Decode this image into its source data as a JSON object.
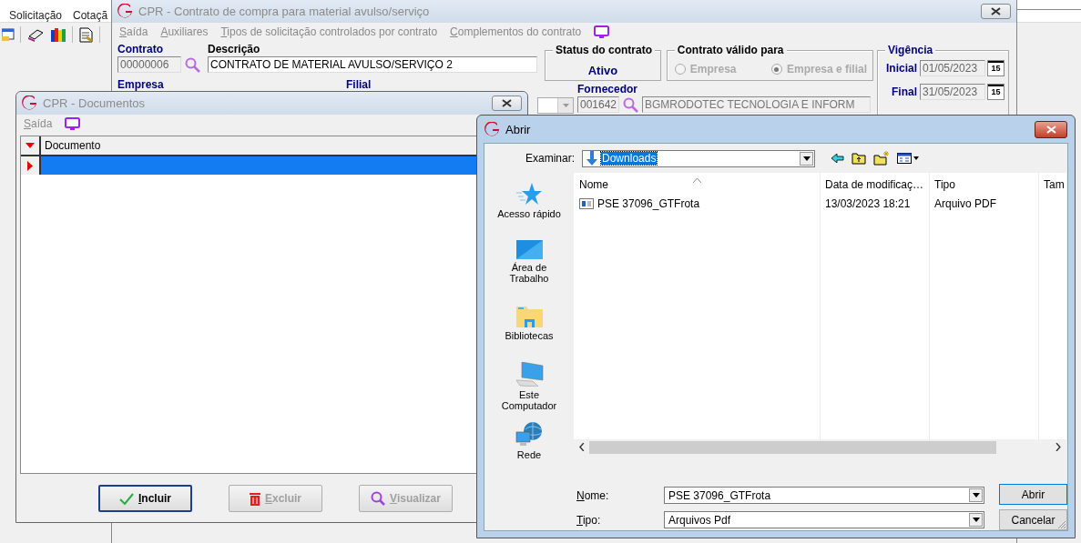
{
  "app": {
    "menu": [
      {
        "label": "Solicitação"
      },
      {
        "label": "Cotaçã"
      }
    ]
  },
  "contract_window": {
    "title": "CPR - Contrato de compra para material avulso/serviço",
    "menu": [
      {
        "label": "Saída"
      },
      {
        "label": "Auxiliares"
      },
      {
        "label": "Tipos de solicitação controlados por contrato"
      },
      {
        "label": "Complementos do contrato"
      }
    ],
    "contrato": {
      "label": "Contrato",
      "value": "00000006"
    },
    "descricao": {
      "label": "Descrição",
      "value": "CONTRATO DE MATERIAL AVULSO/SERVIÇO 2"
    },
    "status": {
      "label": "Status do contrato",
      "value": "Ativo"
    },
    "valid_for": {
      "label": "Contrato válido para",
      "disabled": true,
      "options": [
        {
          "label": "Empresa",
          "selected": false
        },
        {
          "label": "Empresa e filial",
          "selected": true
        }
      ]
    },
    "vigencia": {
      "label": "Vigência",
      "dates": [
        {
          "label": "Inicial",
          "value": "01/05/2023",
          "calendar": "15"
        },
        {
          "label": "Final",
          "value": "31/05/2023",
          "calendar": "15"
        }
      ]
    },
    "empresa": {
      "label": "Empresa"
    },
    "filial": {
      "label": "Filial"
    },
    "fornecedor": {
      "label": "Fornecedor",
      "code": "001642",
      "name": "BGMRODOTEC TECNOLOGIA E INFORM"
    }
  },
  "documents_window": {
    "title": "CPR - Documentos",
    "menu": [
      {
        "label": "Saída"
      }
    ],
    "grid": {
      "columns": [
        "Documento"
      ],
      "rows": [
        {
          "selected": true
        }
      ]
    },
    "buttons": [
      {
        "label": "Incluir",
        "kind": "include",
        "disabled": false
      },
      {
        "label": "Excluir",
        "kind": "delete",
        "disabled": true
      },
      {
        "label": "Visualizar",
        "kind": "view",
        "disabled": true
      }
    ]
  },
  "open_dialog": {
    "title": "Abrir",
    "look_in": {
      "label": "Examinar:",
      "value": "Downloads"
    },
    "places": [
      {
        "label": "Acesso rápido",
        "kind": "quick"
      },
      {
        "label": "Área de Trabalho",
        "kind": "desktop"
      },
      {
        "label": "Bibliotecas",
        "kind": "libraries"
      },
      {
        "label": "Este Computador",
        "kind": "computer"
      },
      {
        "label": "Rede",
        "kind": "network"
      }
    ],
    "columns": [
      "Nome",
      "Data de modificaç…",
      "Tipo",
      "Tam"
    ],
    "files": [
      {
        "name": "PSE 37096_GTFrota",
        "date": "13/03/2023 18:21",
        "type": "Arquivo PDF"
      }
    ],
    "name_field": {
      "label": "Nome:",
      "value": "PSE 37096_GTFrota"
    },
    "type_field": {
      "label": "Tipo:",
      "value": "Arquivos Pdf"
    },
    "buttons": [
      {
        "label": "Abrir",
        "kind": "open"
      },
      {
        "label": "Cancelar",
        "kind": "cancel"
      }
    ]
  }
}
